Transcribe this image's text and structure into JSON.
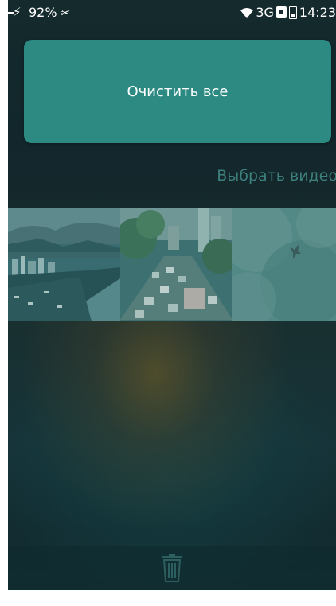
{
  "status_bar": {
    "battery_percent": "92%",
    "network": "3G",
    "time": "14:23",
    "icons": [
      "charging-icon",
      "tools-icon",
      "wifi-icon",
      "sim-icon",
      "battery-icon"
    ]
  },
  "main": {
    "clear_all_label": "Очистить все",
    "select_video_label": "Выбрать видео",
    "thumbnails": [
      {
        "name": "coastal-city-thumbnail"
      },
      {
        "name": "traffic-street-thumbnail"
      },
      {
        "name": "foggy-bird-thumbnail"
      }
    ]
  },
  "bottom_bar": {
    "icons": [
      "trash-icon"
    ]
  },
  "colors": {
    "accent": "#2c8a82",
    "link": "#3c7f7d",
    "background_dark": "#142a2c",
    "thumbnail_tint": "#2a7a78"
  }
}
